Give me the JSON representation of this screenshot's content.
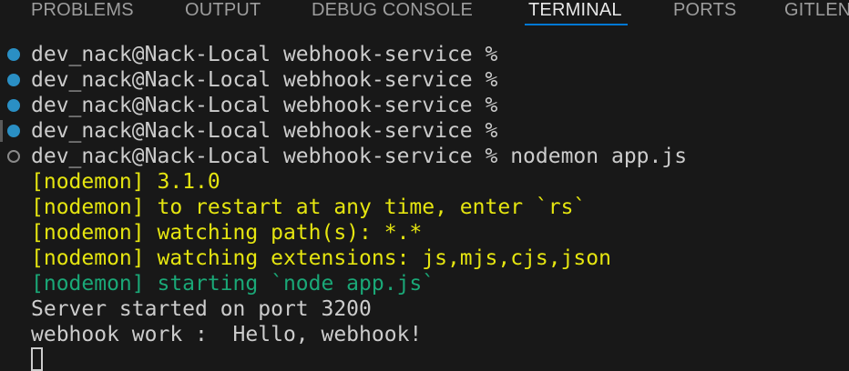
{
  "tabs": [
    {
      "label": "PROBLEMS",
      "active": false
    },
    {
      "label": "OUTPUT",
      "active": false
    },
    {
      "label": "DEBUG CONSOLE",
      "active": false
    },
    {
      "label": "TERMINAL",
      "active": true
    },
    {
      "label": "PORTS",
      "active": false
    },
    {
      "label": "GITLEN",
      "active": false
    }
  ],
  "terminal": {
    "lines": [
      {
        "text": "dev_nack@Nack-Local webhook-service %",
        "decoration": "success"
      },
      {
        "text": "dev_nack@Nack-Local webhook-service %",
        "decoration": "success"
      },
      {
        "text": "dev_nack@Nack-Local webhook-service %",
        "decoration": "success"
      },
      {
        "text": "dev_nack@Nack-Local webhook-service %",
        "decoration": "success"
      },
      {
        "text": "dev_nack@Nack-Local webhook-service % nodemon app.js",
        "decoration": "pending"
      },
      {
        "text": "[nodemon] 3.1.0",
        "decoration": "none"
      },
      {
        "text": "[nodemon] to restart at any time, enter `rs`",
        "decoration": "none"
      },
      {
        "text": "[nodemon] watching path(s): *.*",
        "decoration": "none"
      },
      {
        "text": "[nodemon] watching extensions: js,mjs,cjs,json",
        "decoration": "none"
      },
      {
        "text": "[nodemon] starting `node app.js`",
        "decoration": "none"
      },
      {
        "text": "Server started on port 3200",
        "decoration": "none"
      },
      {
        "text": "webhook work :  Hello, webhook!",
        "decoration": "none"
      }
    ]
  },
  "colors": {
    "background": "#181818",
    "tab_active_underline": "#0078d4",
    "decoration_success": "#2a8fc4",
    "nodemon_yellow": "#e5e510",
    "nodemon_green": "#23d18b",
    "default_text": "#cccccc"
  }
}
